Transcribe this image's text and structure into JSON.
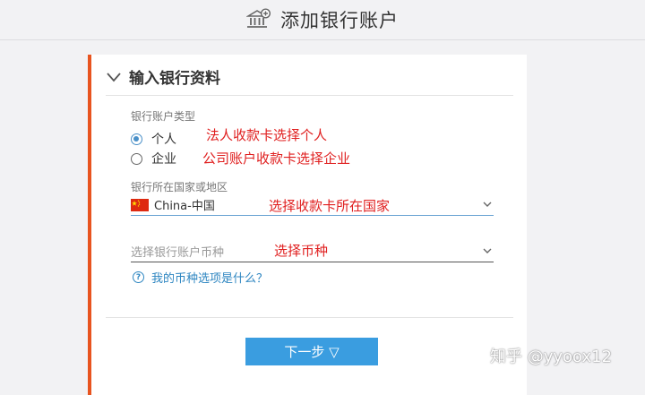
{
  "header": {
    "title": "添加银行账户",
    "icon": "bank-add-icon"
  },
  "section": {
    "title": "输入银行资料",
    "icon": "chevron-down-icon"
  },
  "account_type": {
    "label": "银行账户类型",
    "options": [
      {
        "label": "个人",
        "checked": true
      },
      {
        "label": "企业",
        "checked": false
      }
    ]
  },
  "country": {
    "label": "银行所在国家或地区",
    "value": "China-中国",
    "flag": "china-flag-icon"
  },
  "currency": {
    "placeholder": "选择银行账户币种"
  },
  "help": {
    "text": "我的币种选项是什么？"
  },
  "annotations": {
    "personal": "法人收款卡选择个人",
    "company": "公司账户收款卡选择企业",
    "country": "选择收款卡所在国家",
    "currency": "选择币种"
  },
  "next_button": {
    "label": "下一步 ▽"
  },
  "watermark": "知乎 @yyoox12",
  "colors": {
    "accent_bar": "#e8541f",
    "link": "#2e86c1",
    "button": "#3a9de0",
    "annotation": "#e02020"
  }
}
